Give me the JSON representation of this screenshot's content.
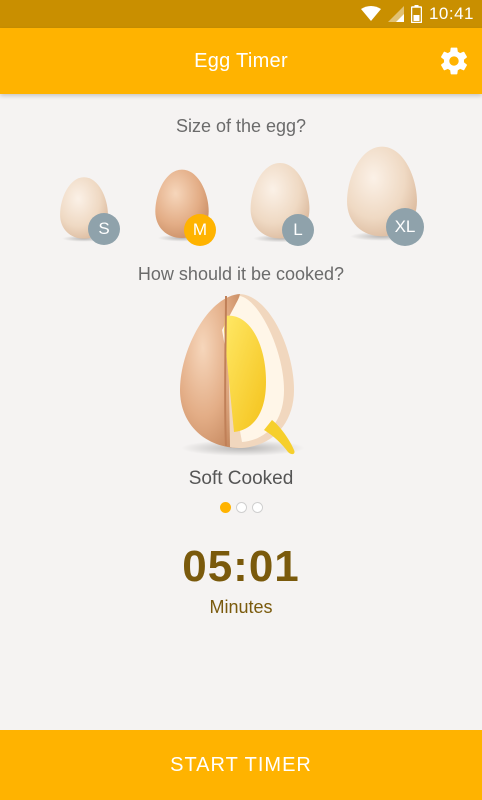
{
  "status_bar": {
    "time": "10:41",
    "icons": [
      "wifi-icon",
      "signal-icon",
      "battery-icon"
    ]
  },
  "app_bar": {
    "title": "Egg Timer",
    "settings_icon": "gear-icon"
  },
  "size_section": {
    "prompt": "Size of the egg?",
    "options": [
      {
        "label": "S",
        "selected": false
      },
      {
        "label": "M",
        "selected": true
      },
      {
        "label": "L",
        "selected": false
      },
      {
        "label": "XL",
        "selected": false
      }
    ]
  },
  "cook_section": {
    "prompt": "How should it be cooked?",
    "current": "Soft Cooked",
    "page_count": 3,
    "current_page": 1
  },
  "timer": {
    "value": "05:01",
    "unit": "Minutes"
  },
  "start_button": {
    "label": "START TIMER"
  },
  "colors": {
    "primary": "#ffb300",
    "status_bar": "#c98f00",
    "background": "#f5f3f2",
    "badge_inactive": "#8fa2ab",
    "timer_text": "#7a5a0c"
  }
}
